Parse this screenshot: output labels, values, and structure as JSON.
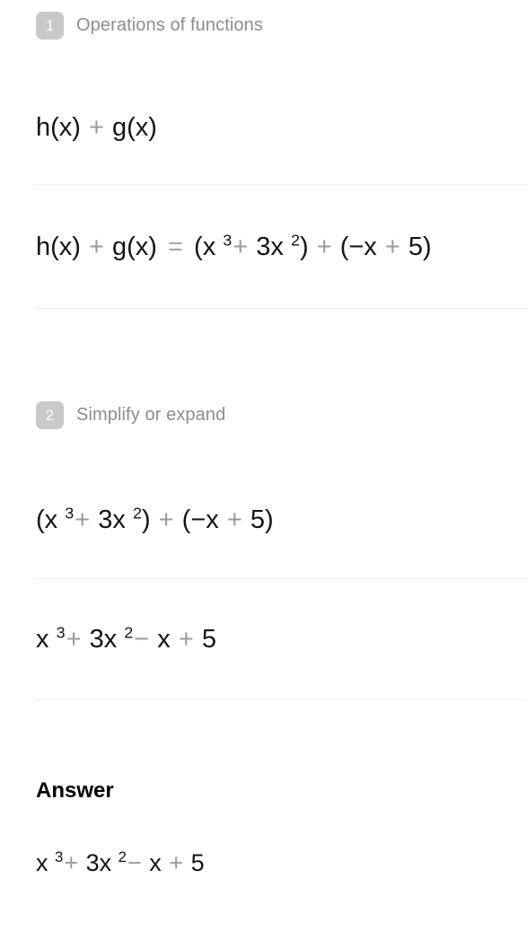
{
  "steps": [
    {
      "badge": "1",
      "title": "Operations of functions",
      "lines": [
        {
          "id": "s1l1",
          "parts": [
            {
              "t": "h(x)",
              "k": "term"
            },
            {
              "t": "+",
              "k": "op"
            },
            {
              "t": "g(x)",
              "k": "term"
            }
          ],
          "plain": "h(x) + g(x)"
        },
        {
          "id": "s1l2",
          "parts": [
            {
              "t": "h(x)",
              "k": "term"
            },
            {
              "t": "+",
              "k": "op"
            },
            {
              "t": "g(x)",
              "k": "term"
            },
            {
              "t": "=",
              "k": "eq"
            },
            {
              "t": "(x",
              "k": "term"
            },
            {
              "t": "3",
              "k": "sup"
            },
            {
              "t": "+",
              "k": "op"
            },
            {
              "t": "3x",
              "k": "term"
            },
            {
              "t": "2",
              "k": "sup"
            },
            {
              "t": ")",
              "k": "term"
            },
            {
              "t": "+",
              "k": "op"
            },
            {
              "t": "(−x",
              "k": "term"
            },
            {
              "t": "+",
              "k": "op"
            },
            {
              "t": "5)",
              "k": "term"
            }
          ],
          "plain": "h(x) + g(x) = (x^3 + 3x^2) + (−x + 5)"
        }
      ]
    },
    {
      "badge": "2",
      "title": "Simplify or expand",
      "lines": [
        {
          "id": "s2l1",
          "parts": [
            {
              "t": "(x",
              "k": "term"
            },
            {
              "t": "3",
              "k": "sup"
            },
            {
              "t": "+",
              "k": "op"
            },
            {
              "t": "3x",
              "k": "term"
            },
            {
              "t": "2",
              "k": "sup"
            },
            {
              "t": ")",
              "k": "term"
            },
            {
              "t": "+",
              "k": "op"
            },
            {
              "t": "(−x",
              "k": "term"
            },
            {
              "t": "+",
              "k": "op"
            },
            {
              "t": "5)",
              "k": "term"
            }
          ],
          "plain": "(x^3 + 3x^2) + (−x + 5)"
        },
        {
          "id": "s2l2",
          "parts": [
            {
              "t": "x",
              "k": "term"
            },
            {
              "t": "3",
              "k": "sup"
            },
            {
              "t": "+",
              "k": "op"
            },
            {
              "t": "3x",
              "k": "term"
            },
            {
              "t": "2",
              "k": "sup"
            },
            {
              "t": "−",
              "k": "op"
            },
            {
              "t": "x",
              "k": "term"
            },
            {
              "t": "+",
              "k": "op"
            },
            {
              "t": "5",
              "k": "term"
            }
          ],
          "plain": "x^3 + 3x^2 − x + 5"
        }
      ]
    }
  ],
  "answer": {
    "heading": "Answer",
    "expression": {
      "id": "ansl1",
      "parts": [
        {
          "t": "x",
          "k": "term"
        },
        {
          "t": "3",
          "k": "sup"
        },
        {
          "t": "+",
          "k": "op"
        },
        {
          "t": "3x",
          "k": "term"
        },
        {
          "t": "2",
          "k": "sup"
        },
        {
          "t": "−",
          "k": "op"
        },
        {
          "t": "x",
          "k": "term"
        },
        {
          "t": "+",
          "k": "op"
        },
        {
          "t": "5",
          "k": "term"
        }
      ],
      "plain": "x^3 + 3x^2 − x + 5"
    }
  },
  "colors": {
    "background": "#ffffff",
    "badge_bg": "#c9c9cb",
    "badge_text": "#ffffff",
    "step_title": "#8d8d8f",
    "expression_text": "#141414",
    "operator_text": "#9b9b9d",
    "divider": "#ececee",
    "answer_heading": "#000000"
  }
}
